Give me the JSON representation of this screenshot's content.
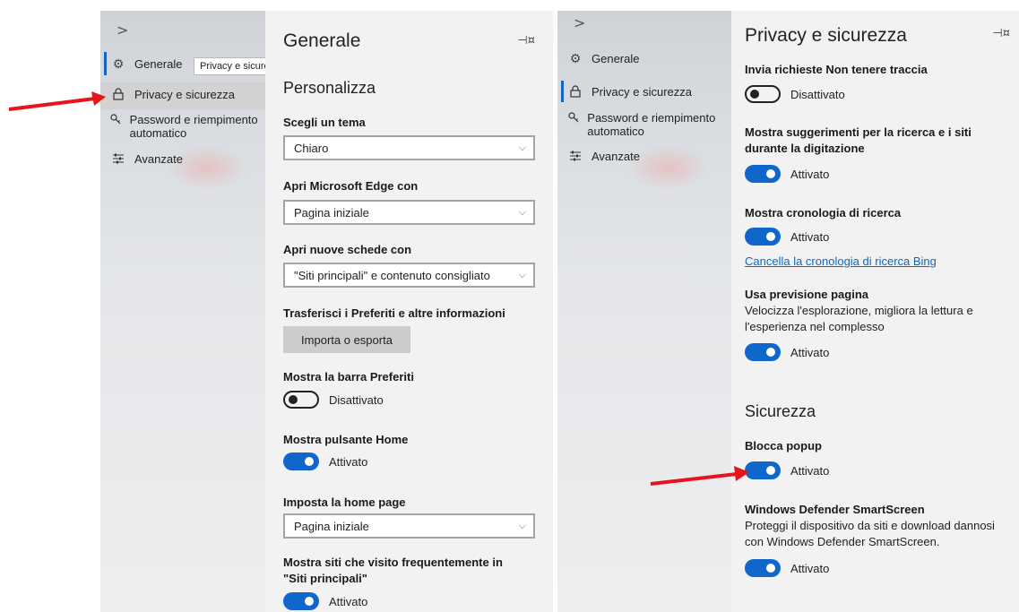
{
  "panel_left": {
    "nav": {
      "items": [
        {
          "icon": "gear-icon",
          "label": "Generale"
        },
        {
          "icon": "lock-icon",
          "label": "Privacy e sicurezza"
        },
        {
          "icon": "key-icon",
          "label": "Password e riempimento automatico"
        },
        {
          "icon": "sliders-icon",
          "label": "Avanzate"
        }
      ],
      "tooltip": "Privacy e sicurezza"
    },
    "title": "Generale",
    "section": "Personalizza",
    "theme": {
      "label": "Scegli un tema",
      "value": "Chiaro"
    },
    "open_with": {
      "label": "Apri Microsoft Edge con",
      "value": "Pagina iniziale"
    },
    "new_tabs": {
      "label": "Apri nuove schede con",
      "value": "\"Siti principali\" e contenuto consigliato"
    },
    "import": {
      "label": "Trasferisci i Preferiti e altre informazioni",
      "button": "Importa o esporta"
    },
    "favorites_bar": {
      "label": "Mostra la barra Preferiti",
      "state": "Disattivato"
    },
    "home_button": {
      "label": "Mostra pulsante Home",
      "state": "Attivato"
    },
    "home_page": {
      "label": "Imposta la home page",
      "value": "Pagina iniziale"
    },
    "top_sites": {
      "label": "Mostra siti che visito frequentemente in \"Siti principali\"",
      "state": "Attivato"
    }
  },
  "panel_right": {
    "nav": {
      "items": [
        {
          "icon": "gear-icon",
          "label": "Generale"
        },
        {
          "icon": "lock-icon",
          "label": "Privacy e sicurezza"
        },
        {
          "icon": "key-icon",
          "label": "Password e riempimento automatico"
        },
        {
          "icon": "sliders-icon",
          "label": "Avanzate"
        }
      ]
    },
    "title": "Privacy e sicurezza",
    "dnt": {
      "label": "Invia richieste Non tenere traccia",
      "state": "Disattivato"
    },
    "suggestions": {
      "label": "Mostra suggerimenti per la ricerca e i siti durante la digitazione",
      "state": "Attivato"
    },
    "history": {
      "label": "Mostra cronologia di ricerca",
      "state": "Attivato",
      "link": "Cancella la cronologia di ricerca Bing"
    },
    "page_prediction": {
      "label": "Usa previsione pagina",
      "desc": "Velocizza l'esplorazione, migliora la lettura e l'esperienza nel complesso",
      "state": "Attivato"
    },
    "security_section": "Sicurezza",
    "popup": {
      "label": "Blocca popup",
      "state": "Attivato"
    },
    "smartscreen": {
      "label": "Windows Defender SmartScreen",
      "desc": "Proteggi il dispositivo da siti e download dannosi con Windows Defender SmartScreen.",
      "state": "Attivato"
    }
  },
  "colors": {
    "accent": "#1166cc",
    "arrow": "#e8141c",
    "link": "#0b68c9"
  }
}
